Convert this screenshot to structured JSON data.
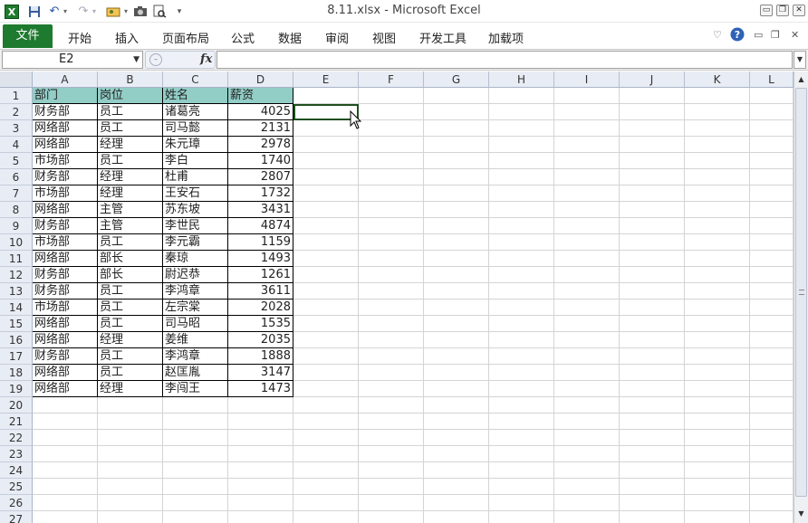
{
  "window": {
    "title": "8.11.xlsx  -  Microsoft Excel",
    "controls": {
      "minimize": "▭",
      "restore": "❐",
      "close": "✕"
    }
  },
  "quick_access": {
    "app_icon": "excel-icon",
    "save_icon": "save-icon",
    "undo_icon": "undo-icon",
    "redo_icon": "redo-icon",
    "customize_icon": "chevron-down-icon"
  },
  "ribbon": {
    "file_tab": "文件",
    "tabs": [
      "开始",
      "插入",
      "页面布局",
      "公式",
      "数据",
      "审阅",
      "视图",
      "开发工具",
      "加载项"
    ]
  },
  "formula_bar": {
    "name_box": "E2",
    "fx_label": "fx",
    "formula": ""
  },
  "sheet": {
    "columns": [
      "A",
      "B",
      "C",
      "D",
      "E",
      "F",
      "G",
      "H",
      "I",
      "J",
      "K",
      "L"
    ],
    "row_numbers": [
      "1",
      "2",
      "3",
      "4",
      "5",
      "6",
      "7",
      "8",
      "9",
      "10",
      "11",
      "12",
      "13",
      "14",
      "15",
      "16",
      "17",
      "18",
      "19",
      "20",
      "21",
      "22",
      "23",
      "24",
      "25",
      "26",
      "27"
    ],
    "selected_cell": "E2",
    "header_fill": "#92cdc6",
    "header_row": [
      "部门",
      "岗位",
      "姓名",
      "薪资"
    ],
    "rows": [
      [
        "财务部",
        "员工",
        "诸葛亮",
        "4025"
      ],
      [
        "网络部",
        "员工",
        "司马懿",
        "2131"
      ],
      [
        "网络部",
        "经理",
        "朱元璋",
        "2978"
      ],
      [
        "市场部",
        "员工",
        "李白",
        "1740"
      ],
      [
        "财务部",
        "经理",
        "杜甫",
        "2807"
      ],
      [
        "市场部",
        "经理",
        "王安石",
        "1732"
      ],
      [
        "网络部",
        "主管",
        "苏东坡",
        "3431"
      ],
      [
        "财务部",
        "主管",
        "李世民",
        "4874"
      ],
      [
        "市场部",
        "员工",
        "李元霸",
        "1159"
      ],
      [
        "网络部",
        "部长",
        "秦琼",
        "1493"
      ],
      [
        "财务部",
        "部长",
        "尉迟恭",
        "1261"
      ],
      [
        "财务部",
        "员工",
        "李鸿章",
        "3611"
      ],
      [
        "市场部",
        "员工",
        "左宗棠",
        "2028"
      ],
      [
        "网络部",
        "员工",
        "司马昭",
        "1535"
      ],
      [
        "网络部",
        "经理",
        "姜维",
        "2035"
      ],
      [
        "财务部",
        "员工",
        "李鸿章",
        "1888"
      ],
      [
        "网络部",
        "员工",
        "赵匡胤",
        "3147"
      ],
      [
        "网络部",
        "经理",
        "李闯王",
        "1473"
      ]
    ]
  }
}
